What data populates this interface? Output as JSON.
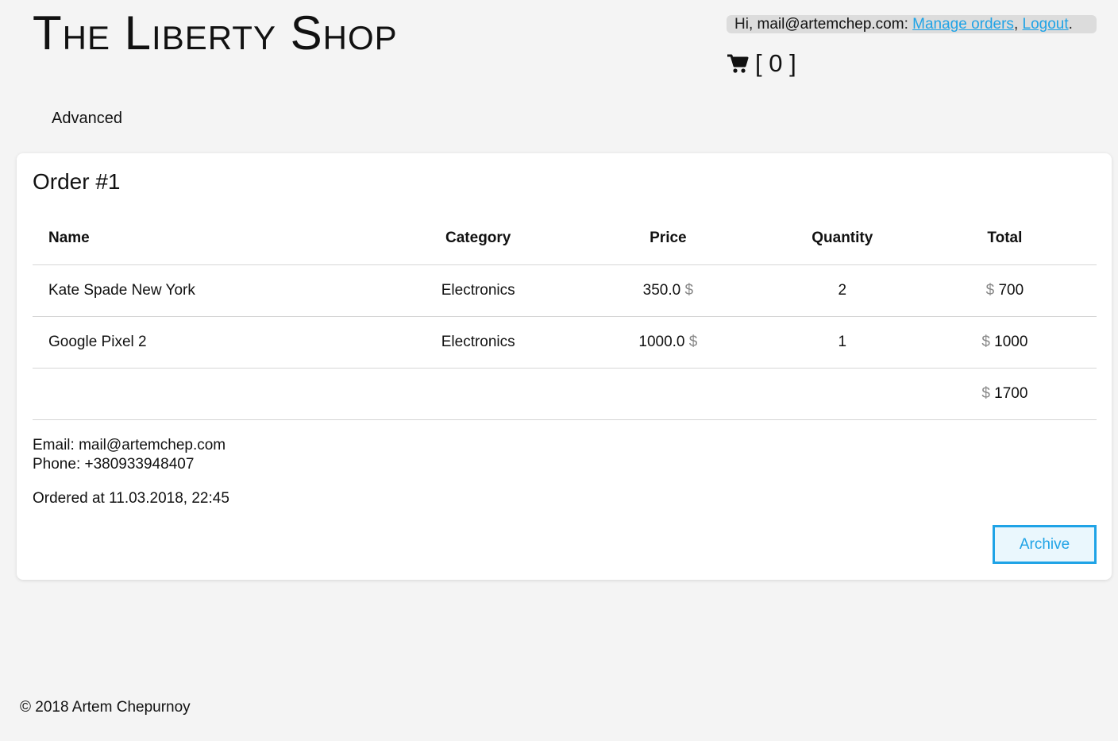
{
  "header": {
    "brand": "The Liberty Shop",
    "greeting_prefix": "Hi, ",
    "user_email": "mail@artemchep.com",
    "greeting_suffix": ": ",
    "manage_orders_label": "Manage orders",
    "separator": ", ",
    "logout_label": "Logout",
    "end_punct": ".",
    "cart_count_text": "[ 0 ]"
  },
  "nav": {
    "advanced_label": "Advanced"
  },
  "order": {
    "title": "Order #1",
    "columns": [
      "Name",
      "Category",
      "Price",
      "Quantity",
      "Total"
    ],
    "rows": [
      {
        "name": "Kate Spade New York",
        "category": "Electronics",
        "price": "350.0",
        "price_currency": "$",
        "quantity": "2",
        "total_currency": "$",
        "total": "700"
      },
      {
        "name": "Google Pixel 2",
        "category": "Electronics",
        "price": "1000.0",
        "price_currency": "$",
        "quantity": "1",
        "total_currency": "$",
        "total": "1000"
      }
    ],
    "grand_total_currency": "$",
    "grand_total": "1700",
    "email_line": "Email: mail@artemchep.com",
    "phone_line": "Phone: +380933948407",
    "ordered_at": "Ordered at 11.03.2018, 22:45",
    "archive_label": "Archive"
  },
  "footer": {
    "copyright": "© 2018 Artem Chepurnoy"
  },
  "colors": {
    "accent": "#1fa3e6",
    "background": "#f4f4f4",
    "card": "#ffffff",
    "currency_gray": "#888888"
  },
  "icons": {
    "cart": "shopping-cart-icon"
  }
}
